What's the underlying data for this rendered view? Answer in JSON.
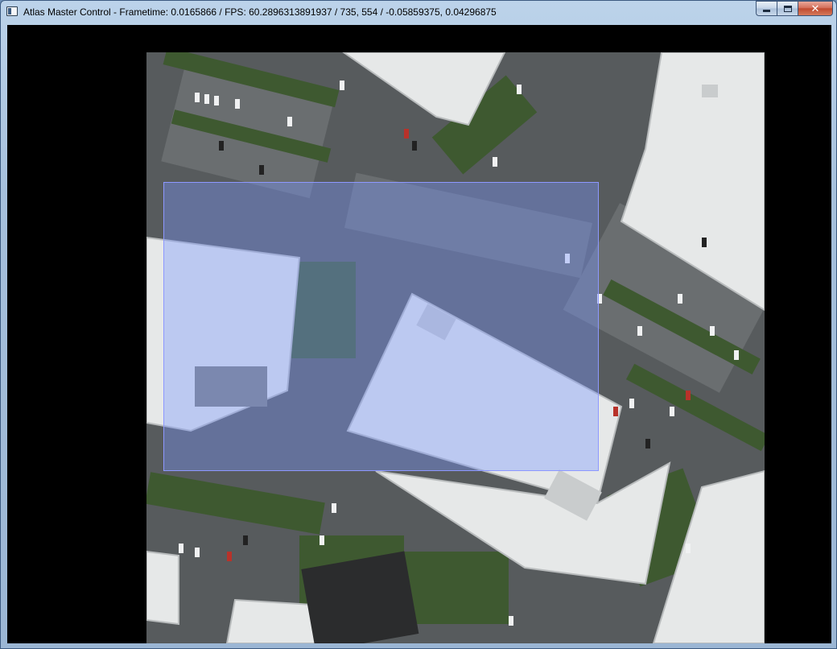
{
  "window": {
    "title": "Atlas Master Control - Frametime: 0.0165866 / FPS: 60.2896313891937 / 735, 554 / -0.05859375, 0.04296875",
    "caption_buttons": {
      "minimize_icon": "minimize-icon",
      "maximize_icon": "maximize-icon",
      "close_icon": "close-icon",
      "close_glyph": "✕"
    }
  },
  "map": {
    "content": "aerial-imagery",
    "selection_fill": "#7896ff",
    "selection_border": "#8d98ff"
  },
  "colors": {
    "background": "#000000",
    "roof": "#e8eaea",
    "pavement": "#5a5d5e",
    "vegetation": "#3f5a2e"
  }
}
